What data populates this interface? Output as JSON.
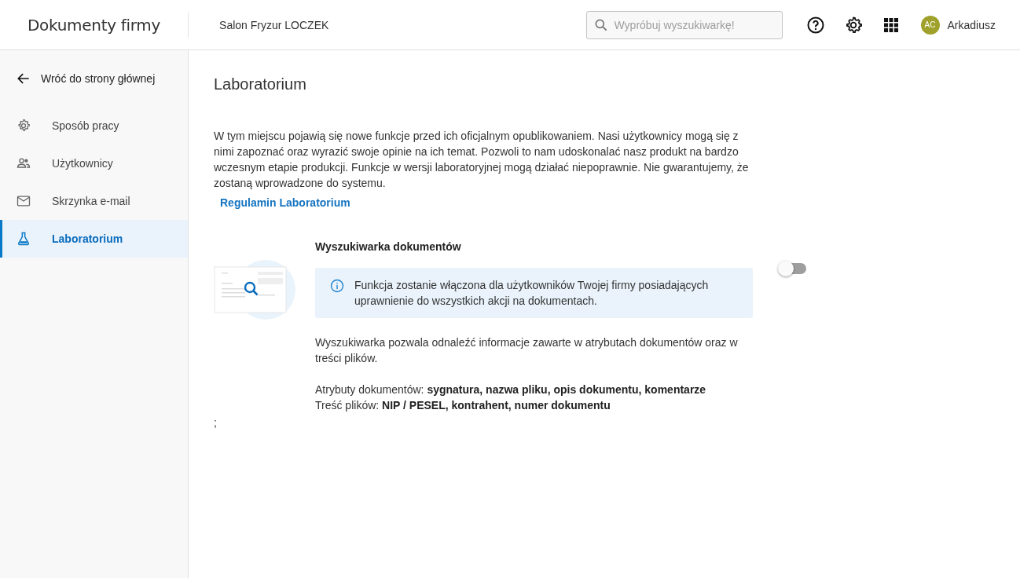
{
  "header": {
    "app_title": "Dokumenty firmy",
    "company": "Salon Fryzur LOCZEK",
    "search": {
      "placeholder": "Wypróbuj wyszukiwarkę!"
    },
    "user": {
      "initials": "AC",
      "name": "Arkadiusz"
    }
  },
  "sidebar": {
    "back": "Wróć do strony głównej",
    "items": [
      {
        "label": "Sposób pracy",
        "kind": "settings",
        "selected": false
      },
      {
        "label": "Użytkownicy",
        "kind": "users",
        "selected": false
      },
      {
        "label": "Skrzynka e-mail",
        "kind": "mail",
        "selected": false
      },
      {
        "label": "Laboratorium",
        "kind": "lab",
        "selected": true
      }
    ]
  },
  "page": {
    "title": "Laboratorium",
    "intro": "W tym miejscu pojawią się nowe funkcje przed ich oficjalnym opublikowaniem. Nasi użytkownicy mogą się z nimi zapoznać oraz wyrazić swoje opinie na ich temat. Pozwoli to nam udoskonalać nasz produkt na bardzo wczesnym etapie produkcji. Funkcje w wersji laboratoryjnej mogą działać niepoprawnie. Nie gwarantujemy, że zostaną wprowadzone do systemu.",
    "terms_link": "Regulamin Laboratorium",
    "features": [
      {
        "title": "Wyszukiwarka dokumentów",
        "on": false,
        "info": "Funkcja zostanie włączona dla użytkowników Twojej firmy posiadających uprawnienie do wszystkich akcji na dokumentach.",
        "description": "Wyszukiwarka pozwala odnaleźć informacje zawarte w atrybutach dokumentów oraz w treści plików.",
        "details": [
          "Atrybuty dokumentów: **sygnatura, nazwa pliku, opis dokumentu, komentarze**",
          "Treść plików: **NIP / PESEL, kontrahent, numer dokumentu**"
        ]
      }
    ],
    "trailing_mark": ";"
  }
}
